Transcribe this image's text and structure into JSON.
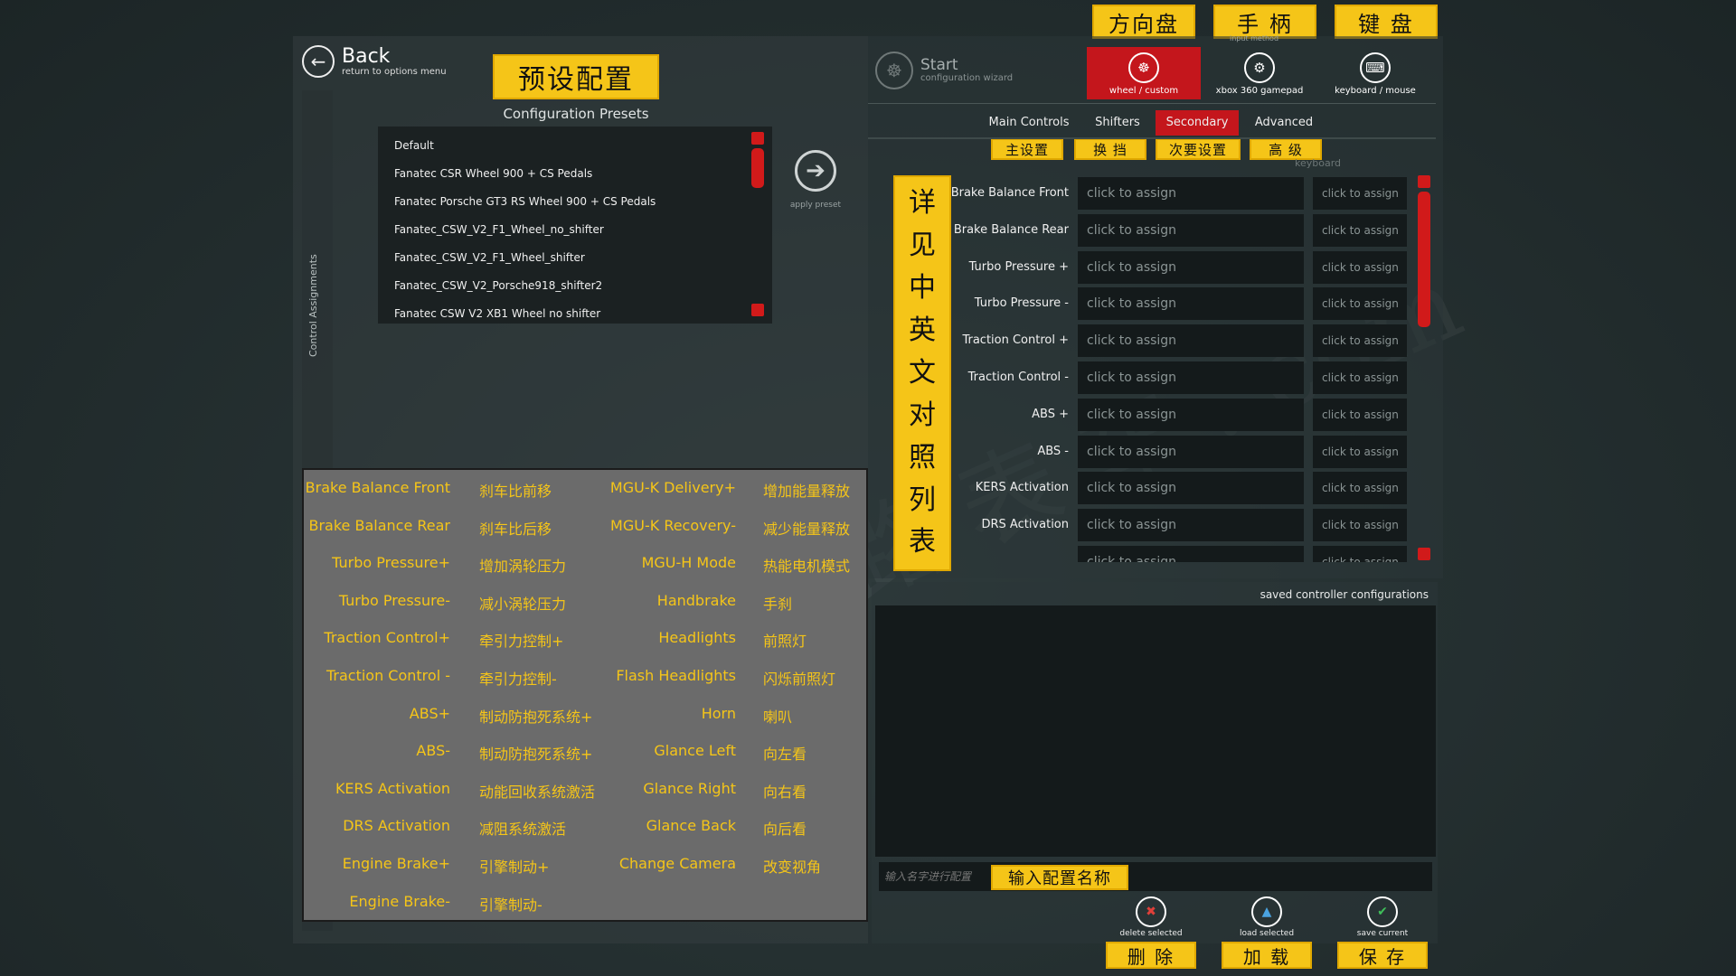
{
  "top_labels": {
    "wheel": "方向盘",
    "gamepad": "手 柄",
    "keyboard": "键 盘"
  },
  "back": {
    "title": "Back",
    "subtitle": "return to options menu"
  },
  "side_label": "Control Assignments",
  "presets": {
    "cn_label": "预设配置",
    "caption": "Configuration Presets",
    "items": [
      "Default",
      "Fanatec CSR Wheel 900 + CS Pedals",
      "Fanatec Porsche GT3 RS Wheel 900 + CS Pedals",
      "Fanatec_CSW_V2_F1_Wheel_no_shifter",
      "Fanatec_CSW_V2_F1_Wheel_shifter",
      "Fanatec_CSW_V2_Porsche918_shifter2",
      "Fanatec CSW V2 XB1 Wheel no shifter"
    ],
    "apply_label": "apply preset"
  },
  "mapping_table": {
    "rows": [
      [
        "Brake Balance Front",
        "刹车比前移",
        "MGU-K Delivery+",
        "增加能量释放"
      ],
      [
        "Brake Balance Rear",
        "刹车比后移",
        "MGU-K Recovery-",
        "减少能量释放"
      ],
      [
        "Turbo Pressure+",
        "增加涡轮压力",
        "MGU-H Mode",
        "热能电机模式"
      ],
      [
        "Turbo Pressure-",
        "减小涡轮压力",
        "Handbrake",
        "手刹"
      ],
      [
        "Traction Control+",
        "牵引力控制+",
        "Headlights",
        "前照灯"
      ],
      [
        "Traction Control -",
        "牵引力控制-",
        "Flash Headlights",
        "闪烁前照灯"
      ],
      [
        "ABS+",
        "制动防抱死系统+",
        "Horn",
        "喇叭"
      ],
      [
        "ABS-",
        "制动防抱死系统+",
        "Glance Left",
        "向左看"
      ],
      [
        "KERS Activation",
        "动能回收系统激活",
        "Glance Right",
        "向右看"
      ],
      [
        "DRS Activation",
        "减阻系统激活",
        "Glance Back",
        "向后看"
      ],
      [
        "Engine Brake+",
        "引擎制动+",
        "Change Camera",
        "改变视角"
      ],
      [
        "Engine Brake-",
        "引擎制动-",
        "",
        ""
      ]
    ]
  },
  "wizard": {
    "title": "Start",
    "subtitle": "configuration wizard"
  },
  "input_method_label": "input method",
  "methods": [
    {
      "label": "wheel / custom",
      "icon": "steering-wheel-icon",
      "active": true
    },
    {
      "label": "xbox 360 gamepad",
      "icon": "gamepad-icon",
      "active": false
    },
    {
      "label": "keyboard / mouse",
      "icon": "keyboard-icon",
      "active": false
    }
  ],
  "tabs": [
    {
      "label": "Main Controls",
      "cn": "主设置",
      "active": false
    },
    {
      "label": "Shifters",
      "cn": "换 挡",
      "active": false
    },
    {
      "label": "Secondary",
      "cn": "次要设置",
      "active": true
    },
    {
      "label": "Advanced",
      "cn": "高 级",
      "active": false
    }
  ],
  "keyboard_column_label": "keyboard",
  "vertical_note": [
    "详",
    "见",
    "中",
    "英",
    "文",
    "对",
    "照",
    "列",
    "表"
  ],
  "assignments": {
    "placeholder": "click to assign",
    "rows": [
      "Brake Balance Front",
      "Brake Balance Rear",
      "Turbo Pressure +",
      "Turbo Pressure -",
      "Traction Control +",
      "Traction Control -",
      "ABS +",
      "ABS -",
      "KERS Activation",
      "DRS Activation",
      ""
    ]
  },
  "saved": {
    "label": "saved controller configurations",
    "name_placeholder": "输入名字进行配置",
    "name_cn_label": "输入配置名称"
  },
  "actions": [
    {
      "label": "delete selected",
      "cn": "删 除",
      "icon": "delete-icon",
      "color": "#e0403a"
    },
    {
      "label": "load selected",
      "cn": "加 载",
      "icon": "load-icon",
      "color": "#4aa3e0"
    },
    {
      "label": "save current",
      "cn": "保 存",
      "icon": "save-icon",
      "color": "#3fbf5a"
    }
  ],
  "colors": {
    "accent": "#c4161c",
    "annotation": "#f5c518"
  }
}
